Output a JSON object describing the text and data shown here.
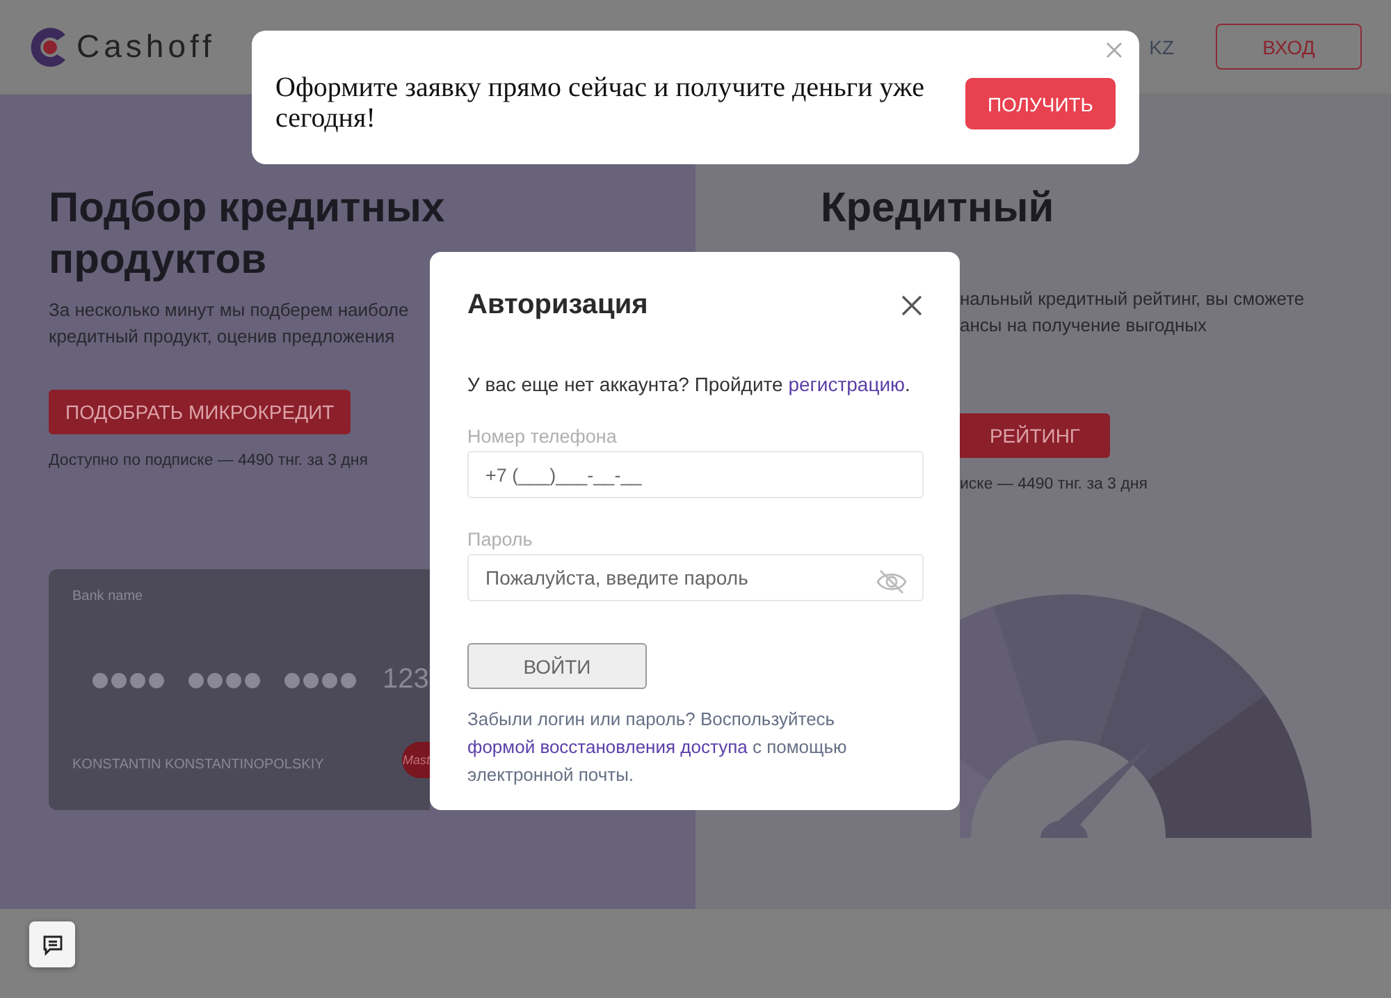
{
  "header": {
    "logo": "Cashoff",
    "language": {
      "label": "KZ",
      "selected": false
    },
    "login_button": "ВХОД"
  },
  "promo_banner": {
    "text": "Оформите заявку прямо сейчас и получите деньги уже сегодня!",
    "button": "ПОЛУЧИТЬ"
  },
  "left_section": {
    "title": "Подбор кредитных продуктов",
    "description_lines": [
      "За несколько минут мы подберем наиболе",
      "кредитный продукт, оценив предложения"
    ],
    "button": "ПОДОБРАТЬ МИКРОКРЕДИТ",
    "note": "Доступно по подписке — 4490 тнг. за 3 дня",
    "card": {
      "bank_name": "Bank name",
      "number_tail": "123",
      "holder": "KONSTANTIN KONSTANTINOPOLSKIY",
      "brand": "Mast"
    }
  },
  "right_section": {
    "title": "Кредитный",
    "description_lines": [
      "нальный кредитный рейтинг, вы сможете",
      "ансы на получение выгодных"
    ],
    "button": "РЕЙТИНГ",
    "note": "иске — 4490 тнг. за 3 дня"
  },
  "auth_modal": {
    "title": "Авторизация",
    "register_prompt": "У вас еще нет аккаунта? Пройдите ",
    "register_link": "регистрацию",
    "register_end": ".",
    "phone_label": "Номер телефона",
    "phone_placeholder": "+7 (___)___-__-__",
    "password_label": "Пароль",
    "password_placeholder": "Пожалуйста, введите пароль",
    "submit_button": "ВОЙТИ",
    "recovery_before": "Забыли логин или пароль? Воспользуйтесь ",
    "recovery_link": "формой восстановления доступа",
    "recovery_after": " с помощью электронной почты."
  }
}
